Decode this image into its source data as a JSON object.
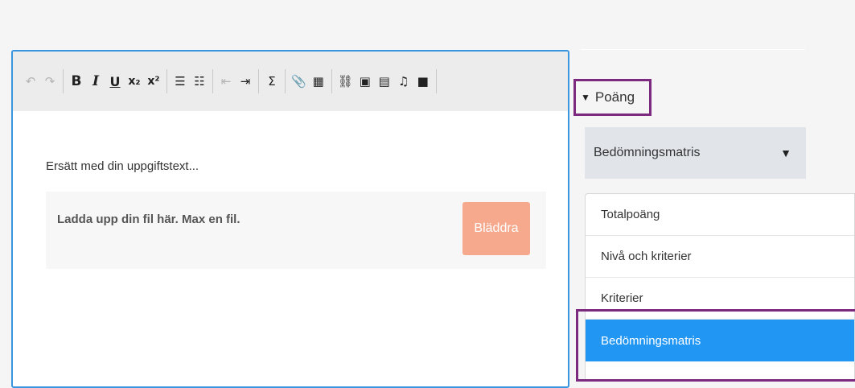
{
  "editor": {
    "toolbar": [
      {
        "name": "undo-icon",
        "glyph": "↶",
        "disabled": true
      },
      {
        "name": "redo-icon",
        "glyph": "↷",
        "disabled": true
      },
      {
        "sep": true
      },
      {
        "name": "bold-button",
        "glyph": "B",
        "style": "b"
      },
      {
        "name": "italic-button",
        "glyph": "I",
        "style": "i"
      },
      {
        "name": "underline-button",
        "glyph": "U",
        "style": "u"
      },
      {
        "name": "subscript-button",
        "glyph": "x₂",
        "style": "sub"
      },
      {
        "name": "superscript-button",
        "glyph": "x²",
        "style": "sup"
      },
      {
        "sep": true
      },
      {
        "name": "ordered-list-icon",
        "glyph": "☰"
      },
      {
        "name": "bullet-list-icon",
        "glyph": "☷"
      },
      {
        "sep": true
      },
      {
        "name": "outdent-icon",
        "glyph": "⇤",
        "disabled": true
      },
      {
        "name": "indent-icon",
        "glyph": "⇥"
      },
      {
        "sep": true
      },
      {
        "name": "sigma-icon",
        "glyph": "Σ"
      },
      {
        "sep": true
      },
      {
        "name": "attachment-icon",
        "glyph": "📎"
      },
      {
        "name": "table-icon",
        "glyph": "▦"
      },
      {
        "sep": true
      },
      {
        "name": "link-icon",
        "glyph": "⛓"
      },
      {
        "name": "image-icon",
        "glyph": "▣"
      },
      {
        "name": "pdf-icon",
        "glyph": "▤"
      },
      {
        "name": "audio-icon",
        "glyph": "♫"
      },
      {
        "name": "video-icon",
        "glyph": "■"
      },
      {
        "sep": true
      }
    ],
    "placeholder": "Ersätt med din uppgiftstext...",
    "upload_text": "Ladda upp din fil här. Max en fil.",
    "browse_label": "Bläddra"
  },
  "points_panel": {
    "header_label": "Poäng",
    "selected_value": "Bedömningsmatris",
    "options": [
      "Totalpoäng",
      "Nivå och kriterier",
      "Kriterier",
      "Bedömningsmatris"
    ],
    "selected_index": 3
  },
  "colors": {
    "accent": "#2196f3",
    "highlight": "#7b2a7f",
    "browse_button": "#f6a98c"
  }
}
